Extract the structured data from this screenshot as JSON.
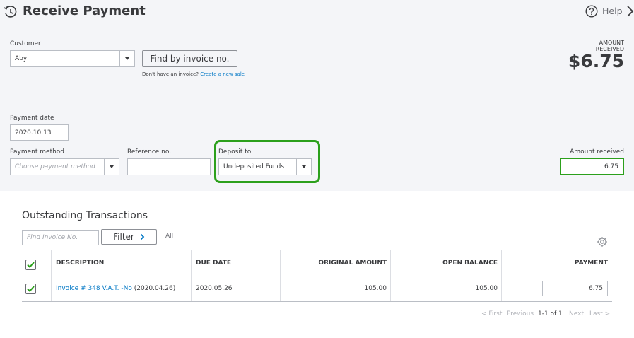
{
  "header": {
    "title": "Receive Payment",
    "help_label": "Help"
  },
  "customer": {
    "label": "Customer",
    "value": "Aby",
    "find_button": "Find by invoice no.",
    "no_invoice_text": "Don't have an invoice?",
    "create_sale_link": "Create a new sale"
  },
  "amount_summary": {
    "label_line1": "AMOUNT",
    "label_line2": "RECEIVED",
    "value": "$6.75"
  },
  "payment_date": {
    "label": "Payment date",
    "value": "2020.10.13"
  },
  "payment_method": {
    "label": "Payment method",
    "placeholder": "Choose payment method"
  },
  "reference": {
    "label": "Reference no.",
    "value": ""
  },
  "deposit_to": {
    "label": "Deposit to",
    "value": "Undeposited Funds"
  },
  "amount_received": {
    "label": "Amount received",
    "value": "6.75"
  },
  "outstanding": {
    "title": "Outstanding Transactions",
    "search_placeholder": "Find Invoice No.",
    "filter_label": "Filter",
    "all_label": "All",
    "columns": [
      "DESCRIPTION",
      "DUE DATE",
      "ORIGINAL AMOUNT",
      "OPEN BALANCE",
      "PAYMENT"
    ],
    "rows": [
      {
        "link": "Invoice # 348 V.A.T. -No",
        "date_suffix": " (2020.04.26)",
        "due_date": "2020.05.26",
        "original_amount": "105.00",
        "open_balance": "105.00",
        "payment": "6.75"
      }
    ]
  },
  "pagination": {
    "first": "< First",
    "previous": "Previous",
    "range": "1-1 of 1",
    "next": "Next",
    "last": "Last >"
  },
  "colors": {
    "accent_green": "#2ca01c",
    "link_blue": "#0077c5",
    "page_bg": "#f4f5f8"
  }
}
